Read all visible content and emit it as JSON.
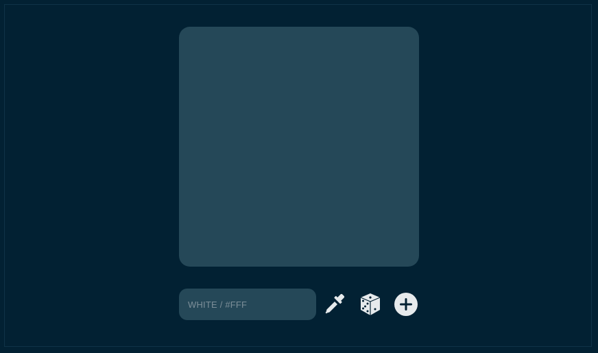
{
  "colors": {
    "background": "#022133",
    "panel": "#254858",
    "icon": "#e6eaec",
    "placeholder": "#7d8f99",
    "border": "#0f3347"
  },
  "color_input": {
    "placeholder": "WHITE / #FFF",
    "value": ""
  },
  "icons": {
    "picker": "eyedropper-icon",
    "random": "dice-icon",
    "add": "plus-circle-icon"
  }
}
